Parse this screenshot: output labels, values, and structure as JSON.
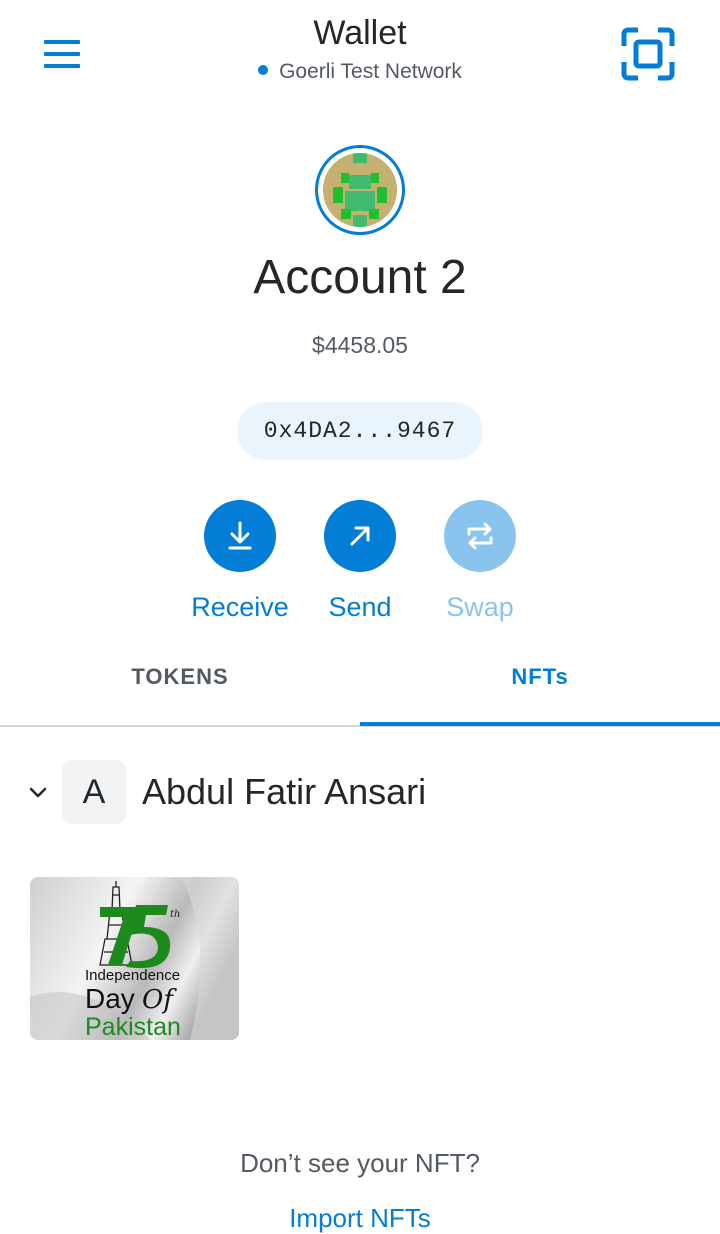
{
  "header": {
    "title": "Wallet",
    "network": "Goerli Test Network",
    "menu_icon": "hamburger-menu-icon",
    "scan_icon": "qr-scan-icon"
  },
  "account": {
    "name": "Account 2",
    "balance": "$4458.05",
    "address": "0x4DA2...9467"
  },
  "actions": [
    {
      "label": "Receive",
      "icon": "download-arrow-icon",
      "enabled": true
    },
    {
      "label": "Send",
      "icon": "arrow-up-right-icon",
      "enabled": true
    },
    {
      "label": "Swap",
      "icon": "swap-arrows-icon",
      "enabled": false
    }
  ],
  "tabs": {
    "tokens": "TOKENS",
    "nfts": "NFTs",
    "active": "nfts"
  },
  "collection": {
    "badge": "A",
    "name": "Abdul Fatir Ansari",
    "expanded": true
  },
  "nft": {
    "superscript": "th",
    "line1": "Independence",
    "line2": "Day",
    "line2_script": "Of",
    "line3": "Pakistan"
  },
  "footer": {
    "prompt": "Don’t see your NFT?",
    "import_link": "Import NFTs"
  },
  "colors": {
    "accent": "#037dd6",
    "accent_disabled": "#8ac4ee",
    "address_bg": "#eaf4fc",
    "nft_green": "#1c8a1c"
  }
}
